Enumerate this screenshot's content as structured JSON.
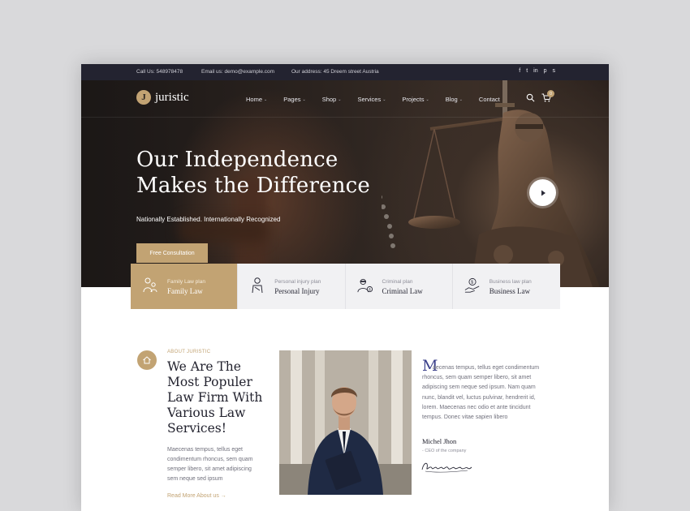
{
  "topbar": {
    "call": "Call Us: 548978478",
    "email": "Email us: demo@example.com",
    "address": "Our address: 45 Dreem street Austria",
    "social": [
      {
        "icon": "facebook-icon",
        "glyph": "f"
      },
      {
        "icon": "twitter-icon",
        "glyph": "t"
      },
      {
        "icon": "linkedin-icon",
        "glyph": "in"
      },
      {
        "icon": "pinterest-icon",
        "glyph": "p"
      },
      {
        "icon": "skype-icon",
        "glyph": "s"
      }
    ]
  },
  "brand": {
    "logo_letter": "J",
    "name": "juristic",
    "accent": "#c2a373"
  },
  "nav": {
    "items": [
      {
        "label": "Home",
        "dropdown": true
      },
      {
        "label": "Pages",
        "dropdown": true
      },
      {
        "label": "Shop",
        "dropdown": true
      },
      {
        "label": "Services",
        "dropdown": true
      },
      {
        "label": "Projects",
        "dropdown": true
      },
      {
        "label": "Blog",
        "dropdown": true
      },
      {
        "label": "Contact",
        "dropdown": false
      }
    ],
    "cart_count": "0"
  },
  "hero": {
    "title_line1": "Our Independence",
    "title_line2": "Makes the Difference",
    "subtitle": "Nationally Established. Internationally Recognized",
    "button": "Free Consultation"
  },
  "practice_cards": [
    {
      "plan": "Family Law plan",
      "name": "Family Law",
      "icon": "family-law-icon",
      "active": true
    },
    {
      "plan": "Personal injury plan",
      "name": "Personal Injury",
      "icon": "personal-injury-icon",
      "active": false
    },
    {
      "plan": "Criminal plan",
      "name": "Criminal Law",
      "icon": "criminal-law-icon",
      "active": false
    },
    {
      "plan": "Business law plan",
      "name": "Business Law",
      "icon": "business-law-icon",
      "active": false
    }
  ],
  "about": {
    "eyebrow": "ABOUT JURISTIC",
    "title_lines": [
      "We Are The",
      "Most Populer",
      "Law Firm With",
      "Various Law",
      "Services!"
    ],
    "text_lines": [
      "Maecenas tempus, tellus eget",
      "condimentum rhoncus, sem quam",
      "semper libero, sit amet adipiscing",
      "sem neque sed ipsum"
    ],
    "read_more": "Read More About us →"
  },
  "quote": {
    "dropcap": "M",
    "lines": [
      "aecenas tempus, tellus eget condimentum",
      "rhoncus, sem quam semper libero, sit amet",
      "adipiscing sem neque sed ipsum. Nam quam",
      "nunc, blandit vel, luctus pulvinar, hendrerit id,",
      "lorem. Maecenas nec odio et ante tincidunt",
      "tempus. Donec vitae sapien libero"
    ],
    "author": "Michel Jhon",
    "role": "- CEO of the company",
    "signature_icon": "signature-image"
  }
}
